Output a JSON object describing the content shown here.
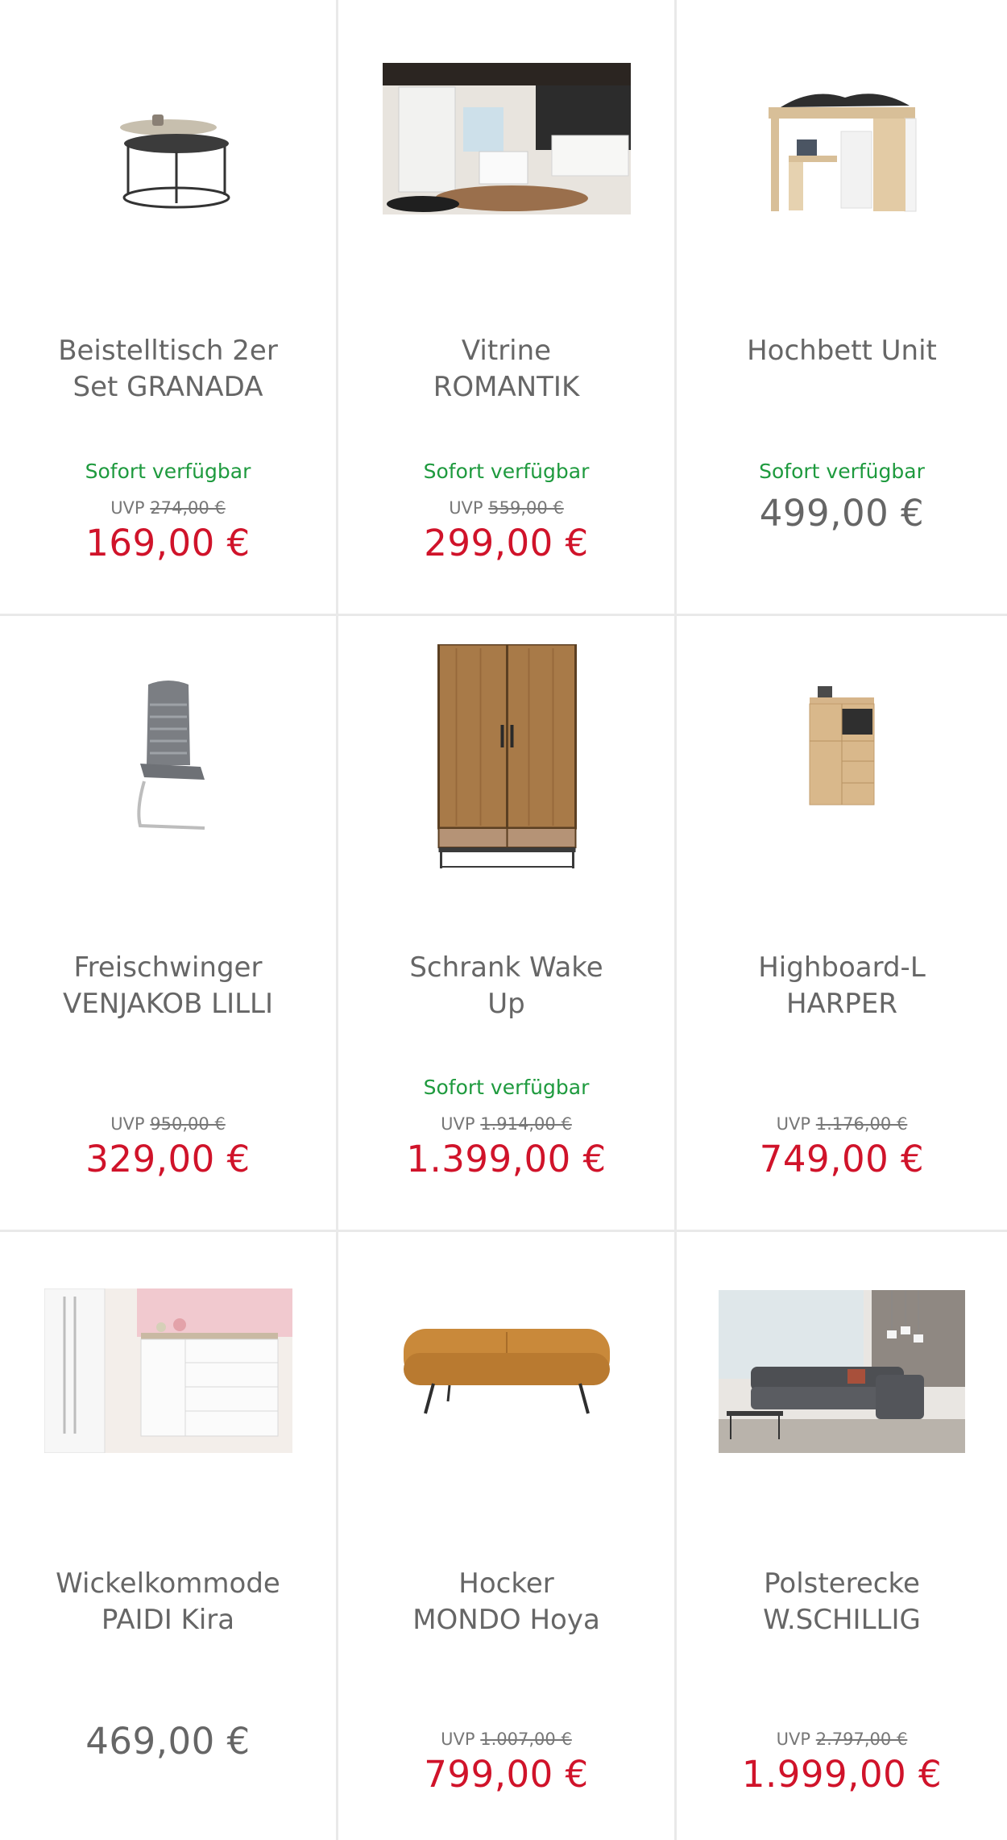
{
  "products": [
    {
      "title_line1": "Beistelltisch 2er",
      "title_line2": "Set GRANADA",
      "availability": "Sofort verfügbar",
      "uvp_label": "UVP",
      "uvp_price": "274,00 €",
      "price": "169,00 €"
    },
    {
      "title_line1": "Vitrine",
      "title_line2": "ROMANTIK",
      "availability": "Sofort verfügbar",
      "uvp_label": "UVP",
      "uvp_price": "559,00 €",
      "price": "299,00 €"
    },
    {
      "title_line1": "Hochbett Unit",
      "title_line2": "",
      "availability": "Sofort verfügbar",
      "uvp_label": "",
      "uvp_price": "",
      "price": "499,00 €"
    },
    {
      "title_line1": "Freischwinger",
      "title_line2": "VENJAKOB LILLI",
      "availability": "",
      "uvp_label": "UVP",
      "uvp_price": "950,00 €",
      "price": "329,00 €"
    },
    {
      "title_line1": "Schrank Wake",
      "title_line2": "Up",
      "availability": "Sofort verfügbar",
      "uvp_label": "UVP",
      "uvp_price": "1.914,00 €",
      "price": "1.399,00 €"
    },
    {
      "title_line1": "Highboard-L",
      "title_line2": "HARPER",
      "availability": "",
      "uvp_label": "UVP",
      "uvp_price": "1.176,00 €",
      "price": "749,00 €"
    },
    {
      "title_line1": "Wickelkommode",
      "title_line2": "PAIDI Kira",
      "availability": "",
      "uvp_label": "",
      "uvp_price": "",
      "price": "469,00 €"
    },
    {
      "title_line1": "Hocker",
      "title_line2": "MONDO Hoya",
      "availability": "",
      "uvp_label": "UVP",
      "uvp_price": "1.007,00 €",
      "price": "799,00 €"
    },
    {
      "title_line1": "Polsterecke",
      "title_line2": "W.SCHILLIG",
      "availability": "",
      "uvp_label": "UVP",
      "uvp_price": "2.797,00 €",
      "price": "1.999,00 €"
    }
  ],
  "colors": {
    "sale_price": "#d0132a",
    "availability": "#1e9a3e",
    "text": "#666666",
    "divider": "#e9e9e9"
  }
}
